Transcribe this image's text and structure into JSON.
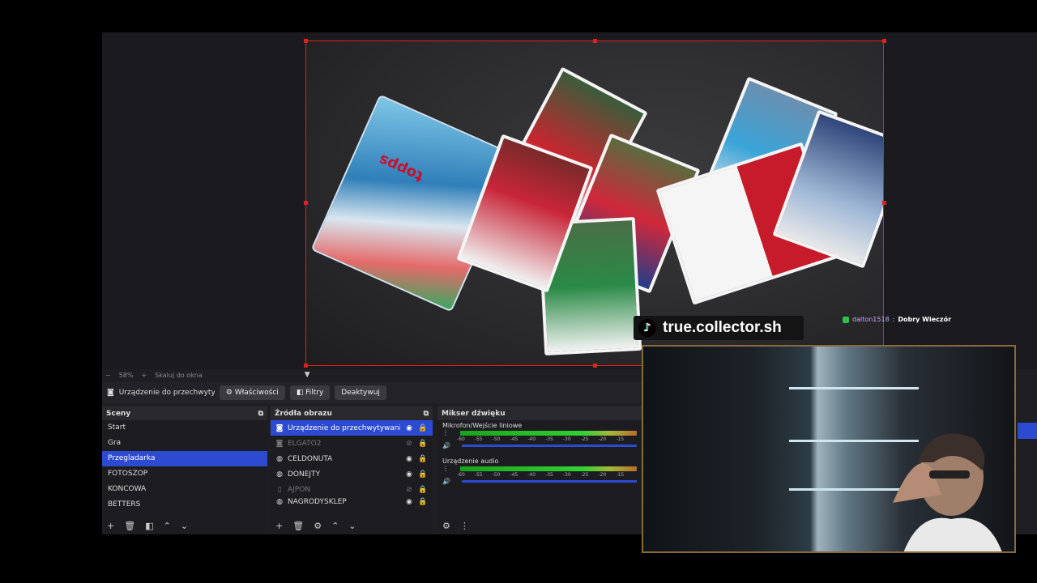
{
  "preview": {
    "zoom": "58%",
    "scale_label": "Skaluj do okna",
    "overlay_handle": "true.collector.sh",
    "pack_brand": "topps"
  },
  "source_bar": {
    "name": "Urządzenie do przechwyty",
    "buttons": [
      "Właściwości",
      "Filtry",
      "Deaktywuj"
    ]
  },
  "scenes": {
    "title": "Sceny",
    "items": [
      "Start",
      "Gra",
      "Przegladarka",
      "FOTOSZOP",
      "KONCOWA",
      "BETTERS"
    ],
    "active": "Przegladarka"
  },
  "sources": {
    "title": "Źródła obrazu",
    "items": [
      {
        "label": "Urządzenie do przechwytywania wid",
        "icon": "camera-icon",
        "visible": true
      },
      {
        "label": "ELGATO2",
        "icon": "camera-icon",
        "visible": false
      },
      {
        "label": "CELDONUTA",
        "icon": "browser-icon",
        "visible": true
      },
      {
        "label": "DONEJTY",
        "icon": "browser-icon",
        "visible": true
      },
      {
        "label": "AJPON",
        "icon": "file-icon",
        "visible": false
      },
      {
        "label": "NAGRODYSKLEP",
        "icon": "browser-icon",
        "visible": true
      }
    ]
  },
  "mixer": {
    "title": "Mikser dźwięku",
    "channels": [
      {
        "name": "Mikrofon/Wejście liniowe",
        "level": 0.85
      },
      {
        "name": "Urządzenie audio",
        "level": 0.6
      }
    ],
    "ticks": [
      "-60",
      "-55",
      "-50",
      "-45",
      "-40",
      "-35",
      "-30",
      "-25",
      "-20",
      "-15"
    ]
  },
  "chat": {
    "user": "dalton1518",
    "message": "Dobry Wieczór"
  },
  "colors": {
    "accent": "#2c4bd1",
    "frame": "#e02020"
  }
}
